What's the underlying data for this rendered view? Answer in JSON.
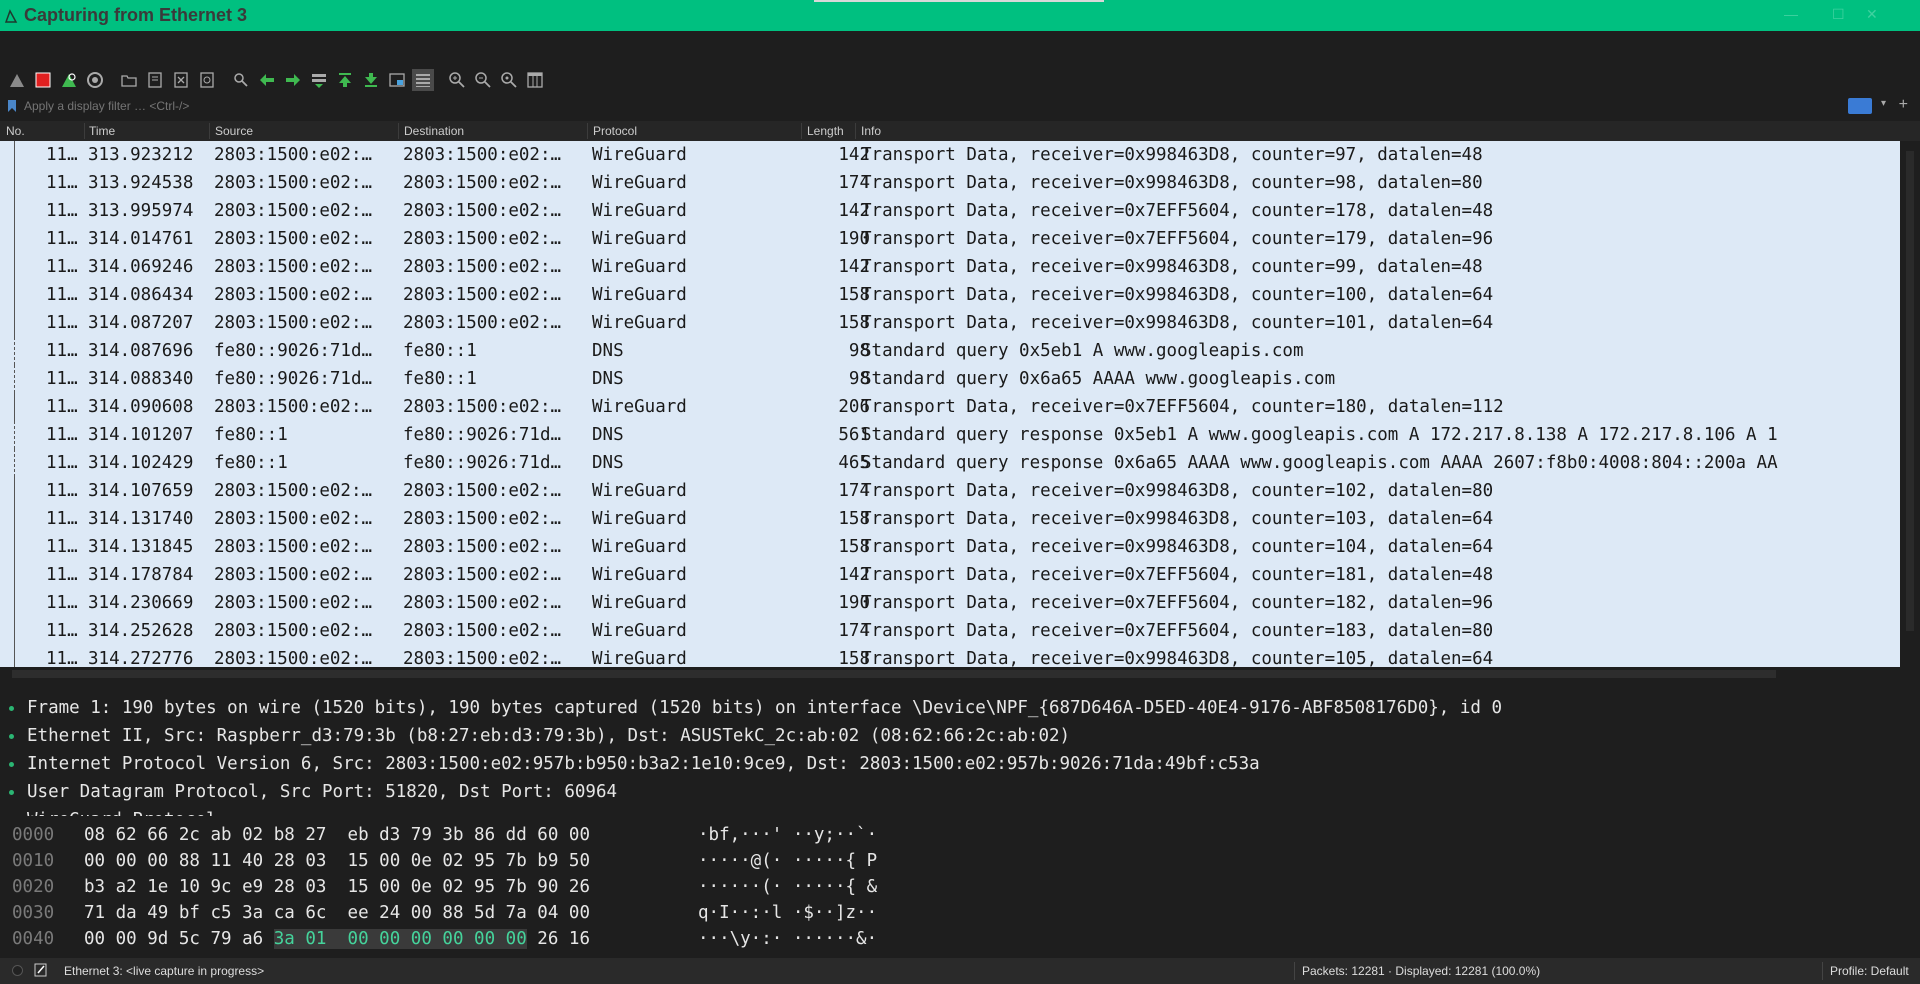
{
  "window": {
    "title": "Capturing from Ethernet 3"
  },
  "toolbar": {
    "icons": [
      "shark-fin-start-icon",
      "stop-capture-icon",
      "restart-capture-icon",
      "capture-options-icon",
      "open-file-icon",
      "save-file-icon",
      "close-file-icon",
      "reload-file-icon",
      "find-packet-icon",
      "go-back-icon",
      "go-forward-icon",
      "go-to-packet-icon",
      "go-first-icon",
      "go-last-icon",
      "auto-scroll-icon",
      "colorize-icon",
      "zoom-in-icon",
      "zoom-out-icon",
      "normal-size-icon",
      "resize-columns-icon"
    ],
    "colors": {
      "green": "#3fb950",
      "red": "#e02020",
      "gray": "#9a9a9a",
      "blue": "#4aa3df"
    }
  },
  "filter": {
    "placeholder": "Apply a display filter … <Ctrl-/>"
  },
  "packet_list": {
    "columns": [
      "No.",
      "Time",
      "Source",
      "Destination",
      "Protocol",
      "Length",
      "Info"
    ],
    "rows": [
      {
        "no": "11…",
        "time": "313.923212",
        "src": "2803:1500:e02:…",
        "dst": "2803:1500:e02:…",
        "proto": "WireGuard",
        "len": "142",
        "info": "Transport Data, receiver=0x998463D8, counter=97, datalen=48"
      },
      {
        "no": "11…",
        "time": "313.924538",
        "src": "2803:1500:e02:…",
        "dst": "2803:1500:e02:…",
        "proto": "WireGuard",
        "len": "174",
        "info": "Transport Data, receiver=0x998463D8, counter=98, datalen=80"
      },
      {
        "no": "11…",
        "time": "313.995974",
        "src": "2803:1500:e02:…",
        "dst": "2803:1500:e02:…",
        "proto": "WireGuard",
        "len": "142",
        "info": "Transport Data, receiver=0x7EFF5604, counter=178, datalen=48"
      },
      {
        "no": "11…",
        "time": "314.014761",
        "src": "2803:1500:e02:…",
        "dst": "2803:1500:e02:…",
        "proto": "WireGuard",
        "len": "190",
        "info": "Transport Data, receiver=0x7EFF5604, counter=179, datalen=96"
      },
      {
        "no": "11…",
        "time": "314.069246",
        "src": "2803:1500:e02:…",
        "dst": "2803:1500:e02:…",
        "proto": "WireGuard",
        "len": "142",
        "info": "Transport Data, receiver=0x998463D8, counter=99, datalen=48"
      },
      {
        "no": "11…",
        "time": "314.086434",
        "src": "2803:1500:e02:…",
        "dst": "2803:1500:e02:…",
        "proto": "WireGuard",
        "len": "158",
        "info": "Transport Data, receiver=0x998463D8, counter=100, datalen=64"
      },
      {
        "no": "11…",
        "time": "314.087207",
        "src": "2803:1500:e02:…",
        "dst": "2803:1500:e02:…",
        "proto": "WireGuard",
        "len": "158",
        "info": "Transport Data, receiver=0x998463D8, counter=101, datalen=64"
      },
      {
        "no": "11…",
        "time": "314.087696",
        "src": "fe80::9026:71d…",
        "dst": "fe80::1",
        "proto": "DNS",
        "len": "98",
        "info": "Standard query 0x5eb1 A www.googleapis.com",
        "dashed": true
      },
      {
        "no": "11…",
        "time": "314.088340",
        "src": "fe80::9026:71d…",
        "dst": "fe80::1",
        "proto": "DNS",
        "len": "98",
        "info": "Standard query 0x6a65 AAAA www.googleapis.com",
        "dashed": true
      },
      {
        "no": "11…",
        "time": "314.090608",
        "src": "2803:1500:e02:…",
        "dst": "2803:1500:e02:…",
        "proto": "WireGuard",
        "len": "206",
        "info": "Transport Data, receiver=0x7EFF5604, counter=180, datalen=112"
      },
      {
        "no": "11…",
        "time": "314.101207",
        "src": "fe80::1",
        "dst": "fe80::9026:71d…",
        "proto": "DNS",
        "len": "561",
        "info": "Standard query response 0x5eb1 A www.googleapis.com A 172.217.8.138 A 172.217.8.106 A 1",
        "dashed": true
      },
      {
        "no": "11…",
        "time": "314.102429",
        "src": "fe80::1",
        "dst": "fe80::9026:71d…",
        "proto": "DNS",
        "len": "465",
        "info": "Standard query response 0x6a65 AAAA www.googleapis.com AAAA 2607:f8b0:4008:804::200a AA",
        "dashed": true
      },
      {
        "no": "11…",
        "time": "314.107659",
        "src": "2803:1500:e02:…",
        "dst": "2803:1500:e02:…",
        "proto": "WireGuard",
        "len": "174",
        "info": "Transport Data, receiver=0x998463D8, counter=102, datalen=80"
      },
      {
        "no": "11…",
        "time": "314.131740",
        "src": "2803:1500:e02:…",
        "dst": "2803:1500:e02:…",
        "proto": "WireGuard",
        "len": "158",
        "info": "Transport Data, receiver=0x998463D8, counter=103, datalen=64"
      },
      {
        "no": "11…",
        "time": "314.131845",
        "src": "2803:1500:e02:…",
        "dst": "2803:1500:e02:…",
        "proto": "WireGuard",
        "len": "158",
        "info": "Transport Data, receiver=0x998463D8, counter=104, datalen=64"
      },
      {
        "no": "11…",
        "time": "314.178784",
        "src": "2803:1500:e02:…",
        "dst": "2803:1500:e02:…",
        "proto": "WireGuard",
        "len": "142",
        "info": "Transport Data, receiver=0x7EFF5604, counter=181, datalen=48"
      },
      {
        "no": "11…",
        "time": "314.230669",
        "src": "2803:1500:e02:…",
        "dst": "2803:1500:e02:…",
        "proto": "WireGuard",
        "len": "190",
        "info": "Transport Data, receiver=0x7EFF5604, counter=182, datalen=96"
      },
      {
        "no": "11…",
        "time": "314.252628",
        "src": "2803:1500:e02:…",
        "dst": "2803:1500:e02:…",
        "proto": "WireGuard",
        "len": "174",
        "info": "Transport Data, receiver=0x7EFF5604, counter=183, datalen=80"
      },
      {
        "no": "11…",
        "time": "314.272776",
        "src": "2803:1500:e02:…",
        "dst": "2803:1500:e02:…",
        "proto": "WireGuard",
        "len": "158",
        "info": "Transport Data, receiver=0x998463D8, counter=105, datalen=64"
      }
    ]
  },
  "details": {
    "lines": [
      "Frame 1: 190 bytes on wire (1520 bits), 190 bytes captured (1520 bits) on interface \\Device\\NPF_{687D646A-D5ED-40E4-9176-ABF8508176D0}, id 0",
      "Ethernet II, Src: Raspberr_d3:79:3b (b8:27:eb:d3:79:3b), Dst: ASUSTekC_2c:ab:02 (08:62:66:2c:ab:02)",
      "Internet Protocol Version 6, Src: 2803:1500:e02:957b:b950:b3a2:1e10:9ce9, Dst: 2803:1500:e02:957b:9026:71da:49bf:c53a",
      "User Datagram Protocol, Src Port: 51820, Dst Port: 60964",
      "WireGuard Protocol"
    ]
  },
  "hex": {
    "rows": [
      {
        "offset": "0000",
        "bytes": [
          "08",
          "62",
          "66",
          "2c",
          "ab",
          "02",
          "b8",
          "27",
          "eb",
          "d3",
          "79",
          "3b",
          "86",
          "dd",
          "60",
          "00"
        ],
        "ascii": "·bf,···' ··y;··`·"
      },
      {
        "offset": "0010",
        "bytes": [
          "00",
          "00",
          "00",
          "88",
          "11",
          "40",
          "28",
          "03",
          "15",
          "00",
          "0e",
          "02",
          "95",
          "7b",
          "b9",
          "50"
        ],
        "ascii": "·····@(· ·····{ P"
      },
      {
        "offset": "0020",
        "bytes": [
          "b3",
          "a2",
          "1e",
          "10",
          "9c",
          "e9",
          "28",
          "03",
          "15",
          "00",
          "0e",
          "02",
          "95",
          "7b",
          "90",
          "26"
        ],
        "ascii": "······(· ·····{ &"
      },
      {
        "offset": "0030",
        "bytes": [
          "71",
          "da",
          "49",
          "bf",
          "c5",
          "3a",
          "ca",
          "6c",
          "ee",
          "24",
          "00",
          "88",
          "5d",
          "7a",
          "04",
          "00"
        ],
        "ascii": "q·I··:·l ·$··]z··"
      },
      {
        "offset": "0040",
        "bytes": [
          "00",
          "00",
          "9d",
          "5c",
          "79",
          "a6",
          "3a",
          "01",
          "00",
          "00",
          "00",
          "00",
          "00",
          "00",
          "26",
          "16"
        ],
        "ascii": "···\\y·:· ······&·",
        "highlight_from": 6
      }
    ]
  },
  "status": {
    "interface": "Ethernet 3: <live capture in progress>",
    "stats": "Packets: 12281 · Displayed: 12281 (100.0%)",
    "profile": "Profile: Default"
  }
}
